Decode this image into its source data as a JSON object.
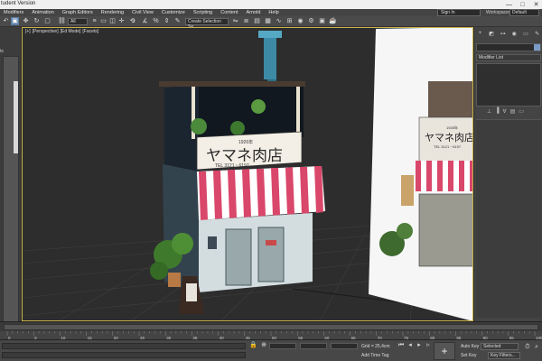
{
  "window": {
    "title": "tudent Version",
    "controls": [
      "—",
      "□",
      "✕"
    ]
  },
  "menu": {
    "items": [
      "Modifiers",
      "Animation",
      "Graph Editors",
      "Rendering",
      "Civil View",
      "Customize",
      "Scripting",
      "Content",
      "Arnold",
      "Help"
    ],
    "sign_in": "Sign In",
    "workspaces_label": "Workspaces:",
    "workspaces_value": "Default"
  },
  "toolbar": {
    "filter_dropdown": "All",
    "number_3": "3",
    "selection_set": "Create Selection Se"
  },
  "left": {
    "label": "ts"
  },
  "viewport": {
    "labels": [
      "[+]",
      "[Perspective]",
      "[Ed Mode]",
      "[Facets]"
    ],
    "sign_kanji": "ヤマネ肉店",
    "sign_small": "1926年",
    "sign_phone": "TEL 3121・6197",
    "ref_sign": "ヤマネ肉店",
    "ref_small": "1926年",
    "ref_phone": "TEL 3121・6197"
  },
  "command_panel": {
    "modifier_list": "Modifier List"
  },
  "timeline": {
    "ticks": [
      "0",
      "5",
      "10",
      "15",
      "20",
      "25",
      "30",
      "35",
      "40",
      "45",
      "50",
      "55",
      "60",
      "65",
      "70",
      "75",
      "80",
      "85",
      "90",
      "95",
      "100"
    ]
  },
  "status": {
    "grid": "Grid = 25,4cm",
    "add_time_tag": "Add Time Tag",
    "auto_key": "Auto Key",
    "set_key": "Set Key",
    "selected": "Selected",
    "key_filters": "Key Filters..."
  },
  "colors": {
    "viewport_active_border": "#c8b44a",
    "awning_red": "#d9476a",
    "accent_blue": "#5b7fa6"
  }
}
